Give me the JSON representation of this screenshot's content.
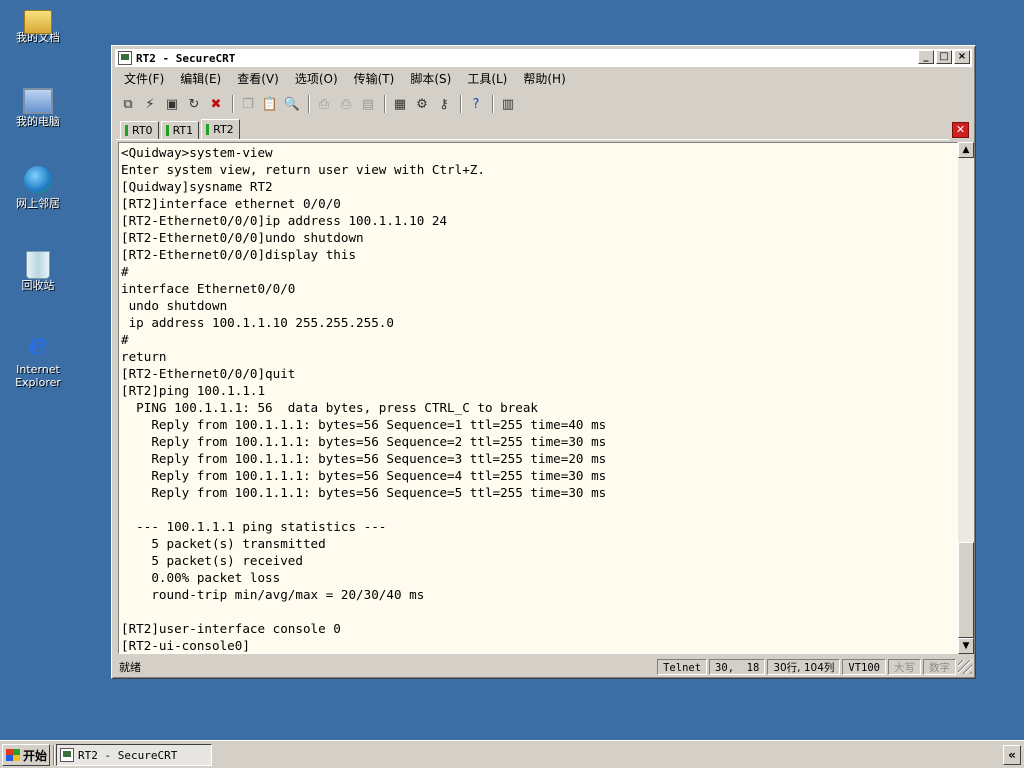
{
  "desktop": {
    "icons": [
      {
        "label": "我的文档"
      },
      {
        "label": "我的电脑"
      },
      {
        "label": "网上邻居"
      },
      {
        "label": "回收站"
      },
      {
        "label": "Internet\nExplorer"
      }
    ]
  },
  "window": {
    "title": "RT2 - SecureCRT",
    "controls": {
      "minimize": "_",
      "maximize": "□",
      "close": "×"
    }
  },
  "menubar": {
    "items": [
      {
        "label": "文件(F)"
      },
      {
        "label": "编辑(E)"
      },
      {
        "label": "查看(V)"
      },
      {
        "label": "选项(O)"
      },
      {
        "label": "传输(T)"
      },
      {
        "label": "脚本(S)"
      },
      {
        "label": "工具(L)"
      },
      {
        "label": "帮助(H)"
      }
    ]
  },
  "toolbar": {
    "icons": [
      "connect-icon",
      "quick-connect-icon",
      "connect-tab-icon",
      "reconnect-icon",
      "disconnect-icon",
      "copy-icon",
      "paste-icon",
      "find-icon",
      "print-icon",
      "print-selection-icon",
      "print-setup-icon",
      "session-options-icon",
      "global-options-icon",
      "key-icon",
      "help-icon",
      "map-icon"
    ]
  },
  "tabs": [
    {
      "label": "RT0",
      "active": false
    },
    {
      "label": "RT1",
      "active": false
    },
    {
      "label": "RT2",
      "active": true
    }
  ],
  "terminal": {
    "lines": [
      "<Quidway>system-view",
      "Enter system view, return user view with Ctrl+Z.",
      "[Quidway]sysname RT2",
      "[RT2]interface ethernet 0/0/0",
      "[RT2-Ethernet0/0/0]ip address 100.1.1.10 24",
      "[RT2-Ethernet0/0/0]undo shutdown",
      "[RT2-Ethernet0/0/0]display this",
      "#",
      "interface Ethernet0/0/0",
      " undo shutdown",
      " ip address 100.1.1.10 255.255.255.0",
      "#",
      "return",
      "[RT2-Ethernet0/0/0]quit",
      "[RT2]ping 100.1.1.1",
      "  PING 100.1.1.1: 56  data bytes, press CTRL_C to break",
      "    Reply from 100.1.1.1: bytes=56 Sequence=1 ttl=255 time=40 ms",
      "    Reply from 100.1.1.1: bytes=56 Sequence=2 ttl=255 time=30 ms",
      "    Reply from 100.1.1.1: bytes=56 Sequence=3 ttl=255 time=20 ms",
      "    Reply from 100.1.1.1: bytes=56 Sequence=4 ttl=255 time=30 ms",
      "    Reply from 100.1.1.1: bytes=56 Sequence=5 ttl=255 time=30 ms",
      "",
      "  --- 100.1.1.1 ping statistics ---",
      "    5 packet(s) transmitted",
      "    5 packet(s) received",
      "    0.00% packet loss",
      "    round-trip min/avg/max = 20/30/40 ms",
      "",
      "[RT2]user-interface console 0",
      "[RT2-ui-console0]"
    ]
  },
  "statusbar": {
    "ready": "就绪",
    "protocol": "Telnet",
    "position": "30,  18",
    "size": "30行, 104列",
    "emulation": "VT100",
    "caps": "大写",
    "num": "数字"
  },
  "taskbar": {
    "start_label": "开始",
    "task_label": "RT2 - SecureCRT",
    "tray_toggle": "«"
  }
}
